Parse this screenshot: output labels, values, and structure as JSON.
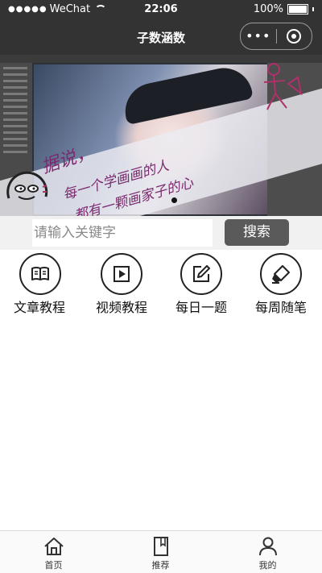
{
  "status_bar": {
    "carrier": "WeChat",
    "time": "22:06",
    "battery": "100%"
  },
  "nav": {
    "title": "子数涵数",
    "menu_icon": "more-dots-icon",
    "close_icon": "capsule-close-icon"
  },
  "banner": {
    "text_line1": "据说，",
    "text_line2": "每一个学画画的人",
    "text_line3": "都有一颗画家子的心"
  },
  "search": {
    "placeholder": "请输入关键字",
    "button_label": "搜索"
  },
  "categories": [
    {
      "label": "文章教程",
      "icon": "book-icon"
    },
    {
      "label": "视频教程",
      "icon": "play-icon"
    },
    {
      "label": "每日一题",
      "icon": "edit-icon"
    },
    {
      "label": "每周随笔",
      "icon": "eraser-icon"
    }
  ],
  "tabbar": {
    "items": [
      {
        "label": "首页",
        "icon": "home-icon"
      },
      {
        "label": "推荐",
        "icon": "bookmark-icon"
      },
      {
        "label": "我的",
        "icon": "user-icon"
      }
    ]
  }
}
